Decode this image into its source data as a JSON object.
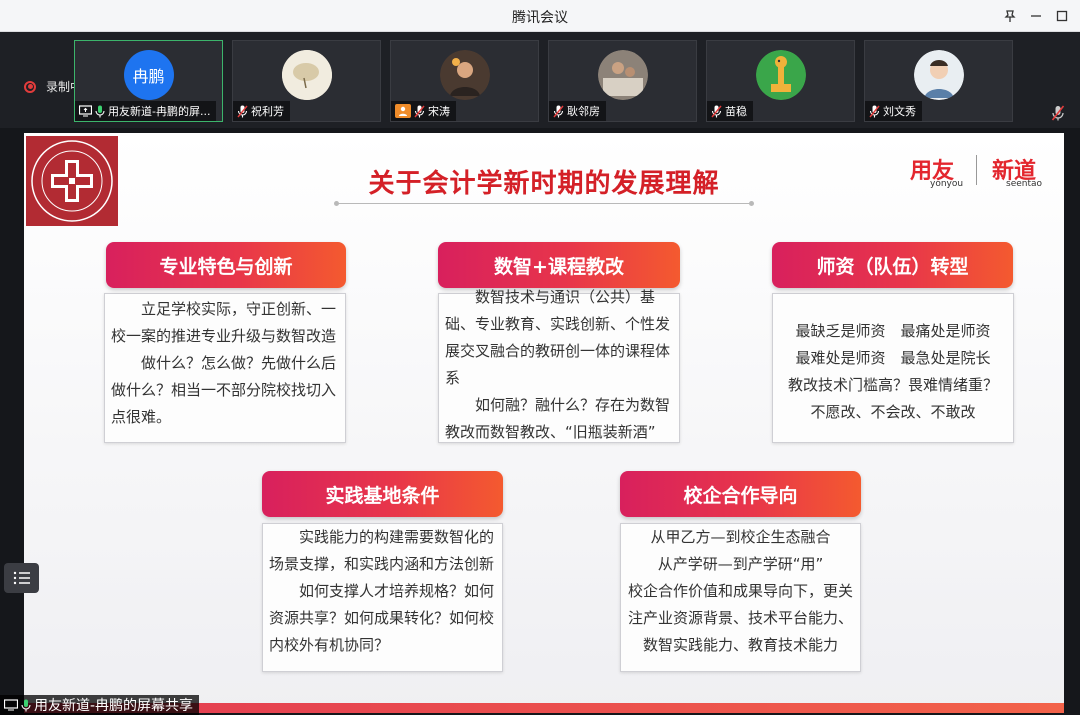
{
  "window": {
    "title": "腾讯会议"
  },
  "recording": {
    "label": "录制中"
  },
  "participants": [
    {
      "name": "用友新道-冉鹏的屏...",
      "avatar_text": "冉鹏",
      "active": true
    },
    {
      "name": "祝利芳"
    },
    {
      "name": "宋涛"
    },
    {
      "name": "耿邻房"
    },
    {
      "name": "苗稳"
    },
    {
      "name": "刘文秀"
    }
  ],
  "slide": {
    "title": "关于会计学新时期的发展理解",
    "brand": {
      "left": "用友",
      "left_sub": "yonyou",
      "right": "新道",
      "right_sub": "seentao"
    },
    "sections": [
      {
        "heading": "专业特色与创新",
        "body": "　　立足学校实际，守正创新、一校一案的推进专业升级与数智改造\n　　做什么？怎么做？先做什么后做什么？相当一不部分院校找切入点很难。"
      },
      {
        "heading": "数智+课程教改",
        "body": "　　数智技术与通识（公共）基础、专业教育、实践创新、个性发展交叉融合的教研创一体的课程体系\n　　如何融？融什么？存在为数智教改而数智教改、“旧瓶装新酒”"
      },
      {
        "heading": "师资（队伍）转型",
        "body": "最缺乏是师资　最痛处是师资\n最难处是师资　最急处是院长\n教改技术门槛高？畏难情绪重？\n不愿改、不会改、不敢改"
      },
      {
        "heading": "实践基地条件",
        "body": "　　实践能力的构建需要数智化的场景支撑，和实践内涵和方法创新\n　　如何支撑人才培养规格？如何资源共享？如何成果转化？如何校内校外有机协同？"
      },
      {
        "heading": "校企合作导向",
        "body": "从甲乙方—到校企生态融合\n从产学研—到产学研“用”\n校企合作价值和成果导向下，更关注产业资源背景、技术平台能力、数智实践能力、教育技术能力"
      }
    ]
  },
  "screen_share": {
    "label": "用友新道-冉鹏的屏幕共享"
  },
  "colors": {
    "accent_red": "#d42027",
    "active_green": "#3cb46b",
    "avatar_blue": "#1e74f0"
  }
}
